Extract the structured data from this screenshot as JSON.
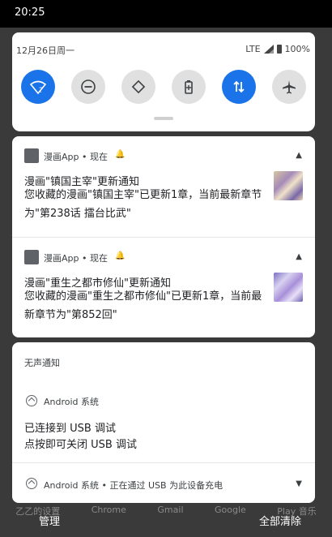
{
  "status_bar": {
    "time": "20:25"
  },
  "quick_settings": {
    "date": "12月26日周一",
    "network": "LTE",
    "battery": "100%",
    "tiles": [
      {
        "name": "wifi",
        "active": true
      },
      {
        "name": "do-not-disturb",
        "active": false
      },
      {
        "name": "auto-rotate",
        "active": false
      },
      {
        "name": "battery-saver",
        "active": false
      },
      {
        "name": "mobile-data",
        "active": true
      },
      {
        "name": "airplane-mode",
        "active": false
      }
    ]
  },
  "notifications": [
    {
      "app": "漫画App",
      "time": "现在",
      "title": "漫画\"镇国主宰\"更新通知",
      "body": "您收藏的漫画\"镇国主宰\"已更新1章，当前最新章节为\"第238话 擂台比武\""
    },
    {
      "app": "漫画App",
      "time": "现在",
      "title": "漫画\"重生之都市修仙\"更新通知",
      "body": "您收藏的漫画\"重生之都市修仙\"已更新1章，当前最新章节为\"第852回\""
    }
  ],
  "silent": {
    "header": "无声通知",
    "system_app": "Android 系统",
    "line1": "已连接到 USB 调试",
    "line2": "点按即可关闭 USB 调试",
    "charging": "Android 系统 • 正在通过 USB 为此设备充电"
  },
  "dock_labels": [
    "乙乙的设置",
    "Chrome",
    "Gmail",
    "Google",
    "Play 音乐"
  ],
  "footer": {
    "manage": "管理",
    "clear_all": "全部清除"
  },
  "colors": {
    "accent": "#1a73e8"
  }
}
